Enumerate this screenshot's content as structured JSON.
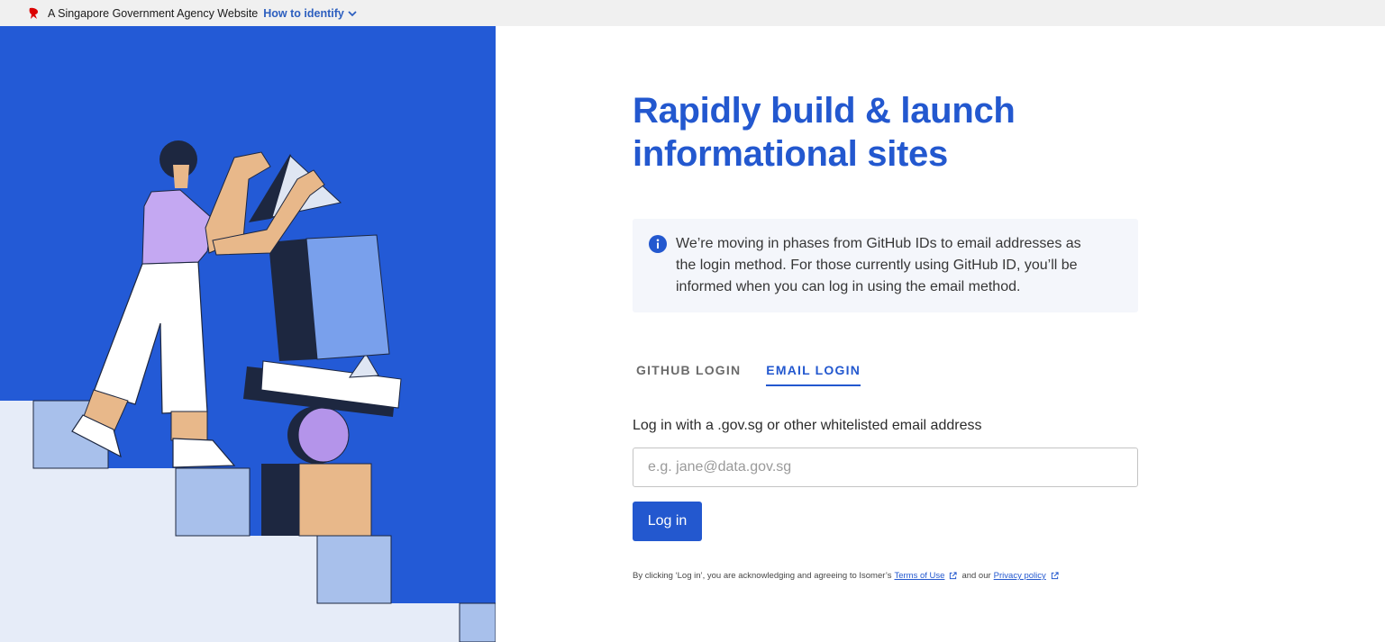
{
  "masthead": {
    "agency_text": "A Singapore Government Agency Website",
    "identify_link": "How to identify"
  },
  "hero": {
    "title_line1": "Rapidly build & launch",
    "title_line2": "informational sites"
  },
  "notice": {
    "line1": "We’re moving in phases from GitHub IDs to email addresses as",
    "line2": "the login method. For those currently using GitHub ID, you’ll be",
    "line3": "informed when you can log in using the email method."
  },
  "tabs": [
    {
      "label": "GITHUB LOGIN",
      "active": false
    },
    {
      "label": "EMAIL LOGIN",
      "active": true
    }
  ],
  "form": {
    "label": "Log in with a .gov.sg or other whitelisted email address",
    "placeholder": "e.g. jane@data.gov.sg",
    "value": "",
    "submit_label": "Log in"
  },
  "disclaimer": {
    "prefix": "By clicking ‘Log in’, you are acknowledging and agreeing to Isomer’s",
    "terms_link": "Terms of Use",
    "middle": "and our",
    "privacy_link": "Privacy policy"
  },
  "colors": {
    "brand_blue": "#2358cf",
    "panel_blue": "#235ad6",
    "info_bg": "#f4f6fb"
  }
}
